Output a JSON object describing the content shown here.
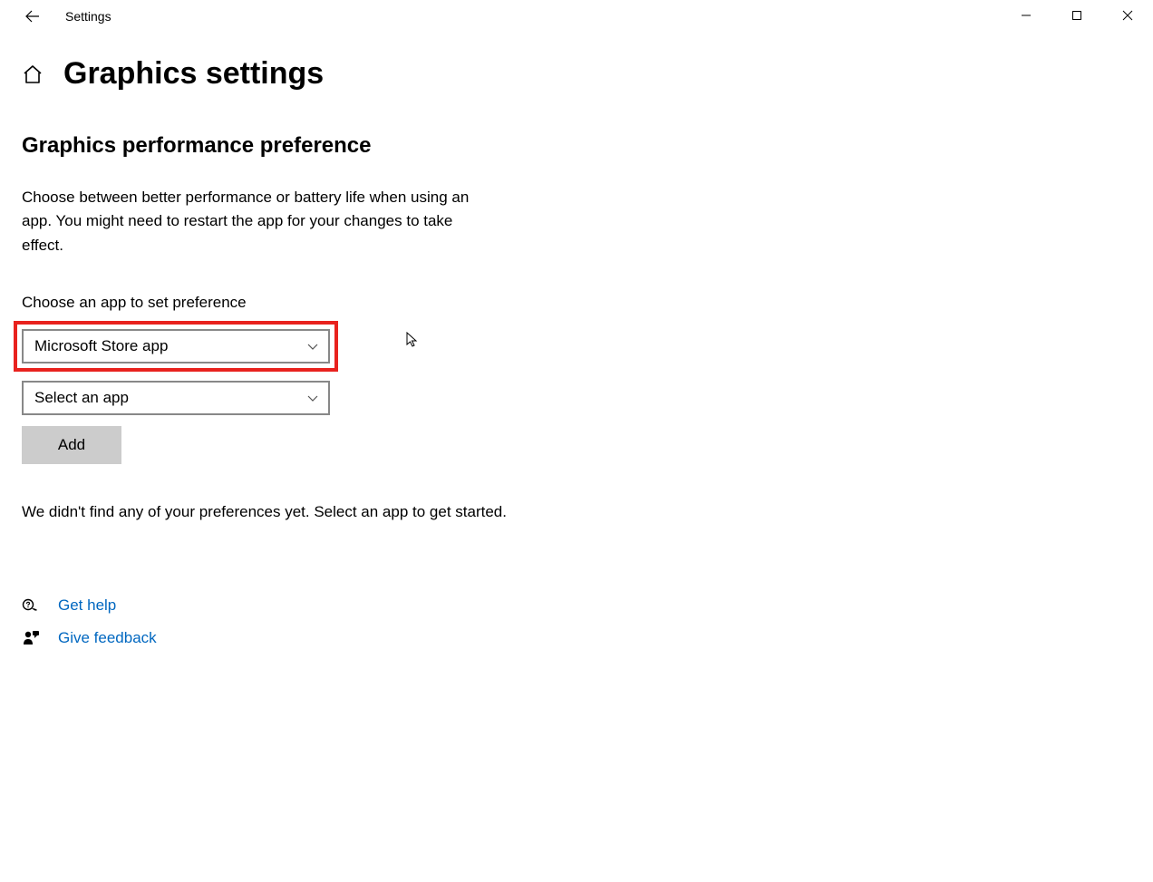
{
  "titlebar": {
    "app_name": "Settings"
  },
  "header": {
    "title": "Graphics settings"
  },
  "section": {
    "heading": "Graphics performance preference",
    "description": "Choose between better performance or battery life when using an app. You might need to restart the app for your changes to take effect.",
    "choose_label": "Choose an app to set preference"
  },
  "dropdowns": {
    "app_type_selected": "Microsoft Store app",
    "app_select_selected": "Select an app"
  },
  "buttons": {
    "add": "Add"
  },
  "messages": {
    "empty": "We didn't find any of your preferences yet. Select an app to get started."
  },
  "links": {
    "help": "Get help",
    "feedback": "Give feedback"
  }
}
